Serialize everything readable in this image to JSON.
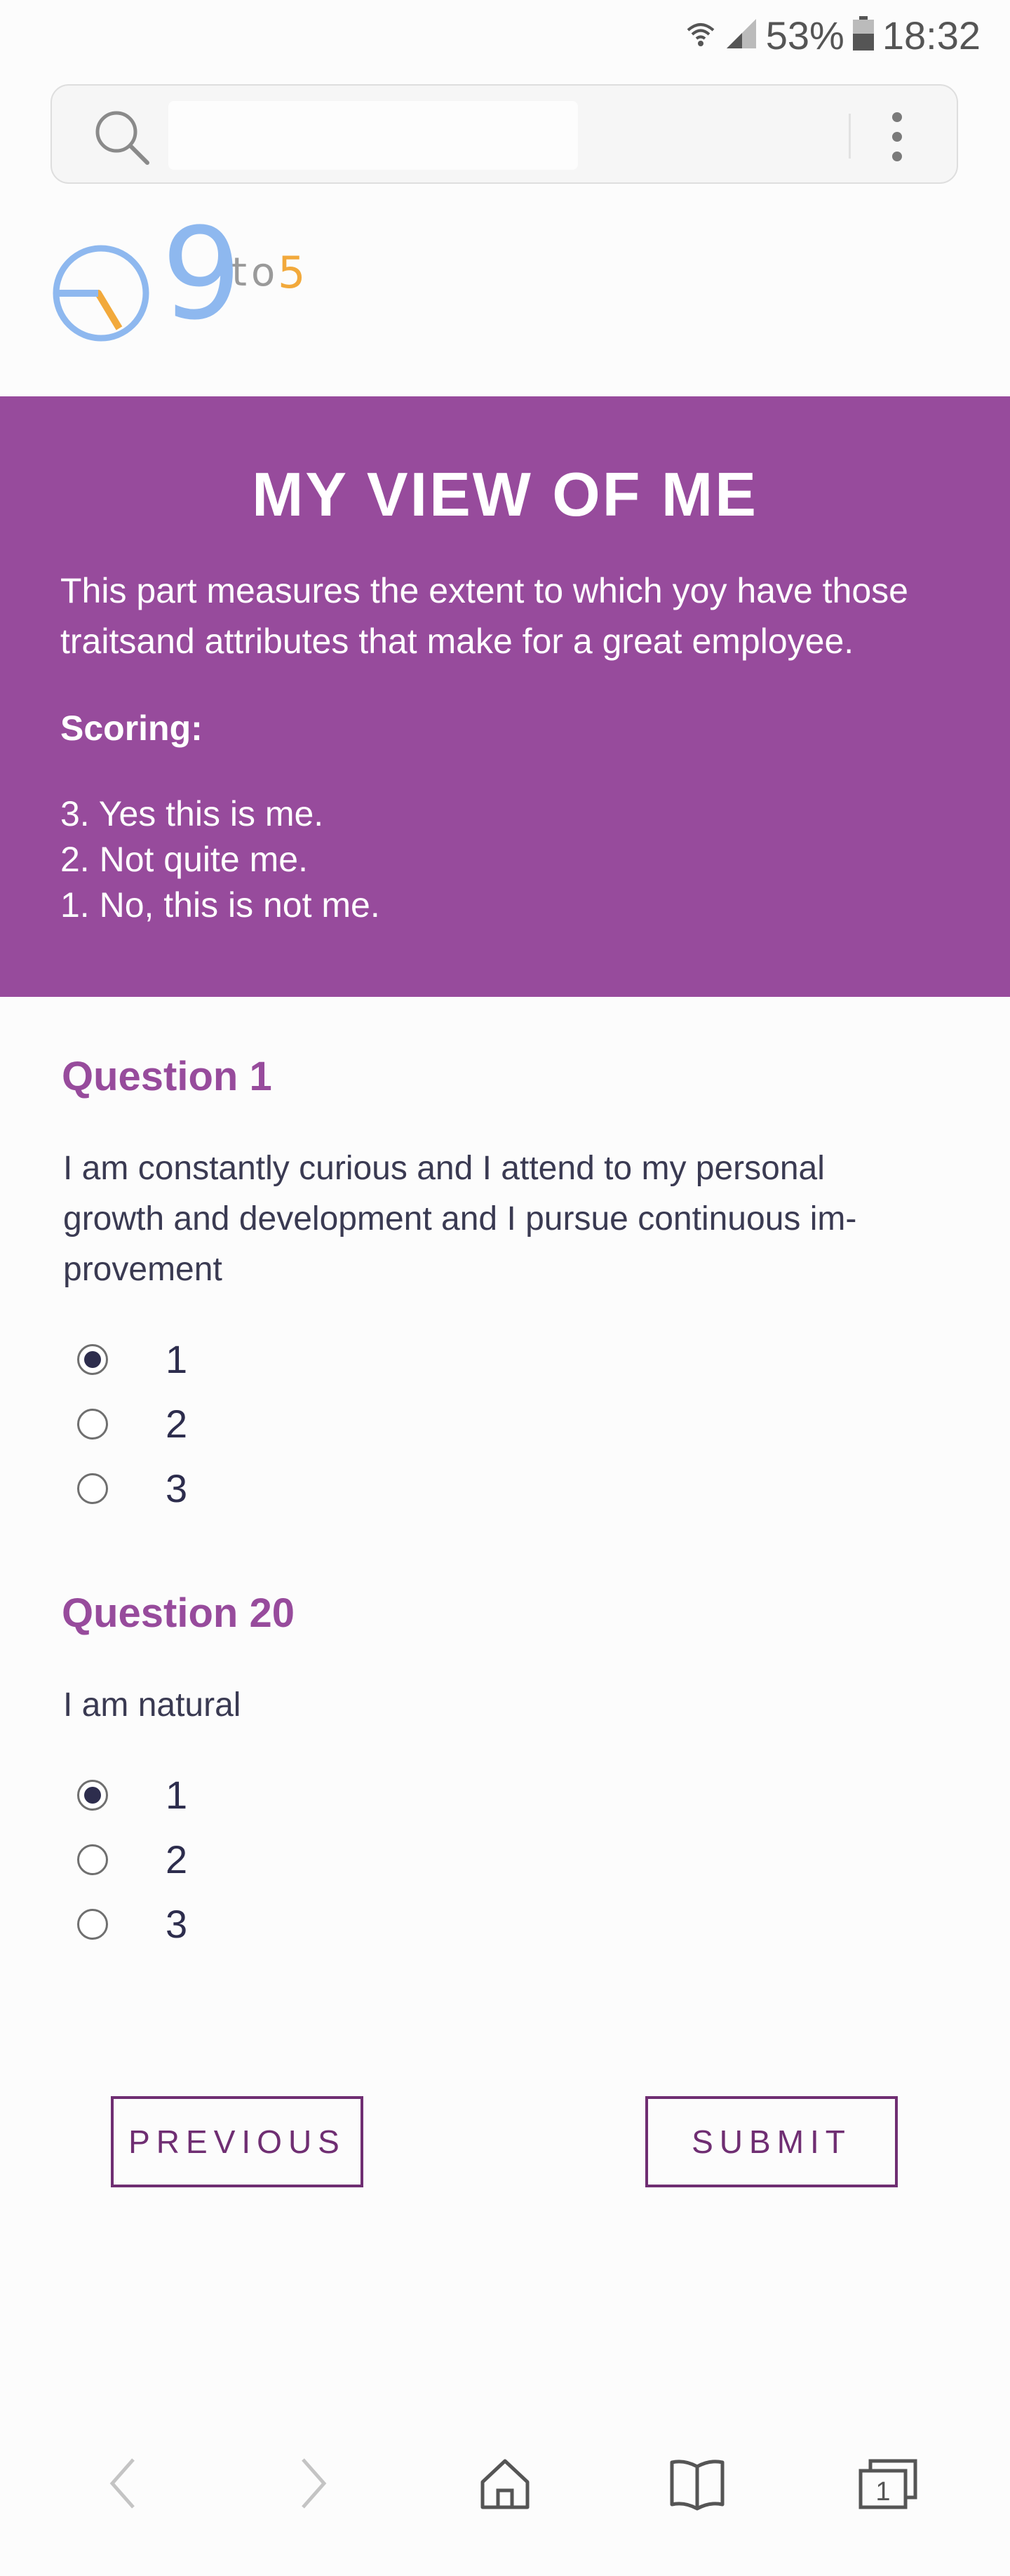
{
  "status_bar": {
    "battery": "53%",
    "time": "18:32",
    "icons": [
      "wifi-icon",
      "signal-icon",
      "battery-icon"
    ]
  },
  "browser": {
    "url_value": "",
    "icons": [
      "search-icon",
      "more-vert-icon"
    ]
  },
  "logo": {
    "nine": "9",
    "to": "to",
    "five": "5"
  },
  "banner": {
    "title": "MY VIEW OF ME",
    "description_line1": "This part measures the extent to which yoy have  those",
    "description_line2": "traitsand attributes that make for a great  employee.",
    "scoring_label": "Scoring:",
    "scores": [
      "3. Yes this is me.",
      "2. Not quite me.",
      "1. No, this is not me."
    ]
  },
  "questions": [
    {
      "title": "Question 1",
      "text_line1": "I am constantly curious and I attend to my personal",
      "text_line2": "growth and development and I pursue  continuous im-",
      "text_line3": "provement",
      "options": [
        "1",
        "2",
        "3"
      ],
      "selected": "1"
    },
    {
      "title": "Question 20",
      "text_line1": "I am natural",
      "options": [
        "1",
        "2",
        "3"
      ],
      "selected": "1"
    }
  ],
  "buttons": {
    "previous": "PREVIOUS",
    "submit": "SUBMIT"
  },
  "bottom_nav": {
    "icons": [
      "back-icon",
      "forward-icon",
      "home-icon",
      "bookmarks-icon",
      "tabs-icon"
    ],
    "tab_count": "1"
  },
  "colors": {
    "accent": "#974b9c",
    "button": "#6f2e72",
    "logo_blue": "#8eb8ef",
    "logo_orange": "#f2a93b"
  }
}
